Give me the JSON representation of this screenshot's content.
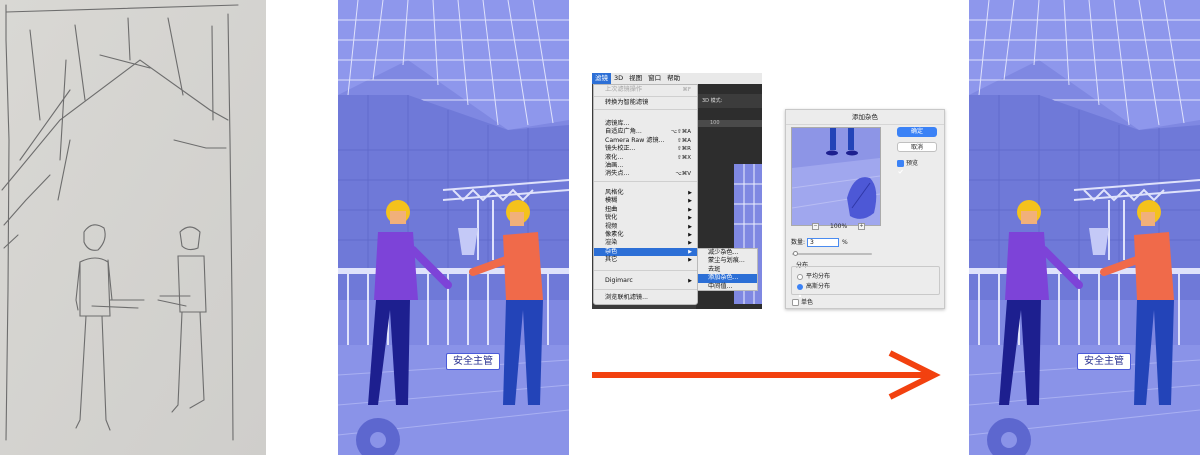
{
  "illustration": {
    "badge_label": "安全主管"
  },
  "photoshop_menu": {
    "menubar": [
      "滤镜",
      "3D",
      "视图",
      "窗口",
      "帮助"
    ],
    "active_menu": "滤镜",
    "options_bar_text": "3D 模式:",
    "ruler_text": "100",
    "items": [
      {
        "label": "上次滤镜操作",
        "shortcut": "⌘F",
        "disabled": true
      },
      {
        "label": "转换为智能滤镜",
        "shortcut": ""
      },
      {
        "label": "滤镜库...",
        "shortcut": ""
      },
      {
        "label": "自适应广角...",
        "shortcut": "⌥⇧⌘A"
      },
      {
        "label": "Camera Raw 滤镜...",
        "shortcut": "⇧⌘A"
      },
      {
        "label": "镜头校正...",
        "shortcut": "⇧⌘R"
      },
      {
        "label": "液化...",
        "shortcut": "⇧⌘X"
      },
      {
        "label": "油画...",
        "shortcut": ""
      },
      {
        "label": "消失点...",
        "shortcut": "⌥⌘V"
      },
      {
        "label": "风格化",
        "submenu": true
      },
      {
        "label": "模糊",
        "submenu": true
      },
      {
        "label": "扭曲",
        "submenu": true
      },
      {
        "label": "锐化",
        "submenu": true
      },
      {
        "label": "视频",
        "submenu": true
      },
      {
        "label": "像素化",
        "submenu": true
      },
      {
        "label": "渲染",
        "submenu": true
      },
      {
        "label": "杂色",
        "submenu": true,
        "highlighted": true
      },
      {
        "label": "其它",
        "submenu": true
      },
      {
        "label": "Digimarc",
        "submenu": true
      },
      {
        "label": "浏览联机滤镜..."
      }
    ],
    "noise_submenu": [
      {
        "label": "减少杂色..."
      },
      {
        "label": "蒙尘与划痕..."
      },
      {
        "label": "去斑"
      },
      {
        "label": "添加杂色...",
        "highlighted": true
      },
      {
        "label": "中间值..."
      }
    ]
  },
  "add_noise_dialog": {
    "title": "添加杂色",
    "ok_label": "确定",
    "cancel_label": "取消",
    "preview_label": "预览",
    "preview_checked": true,
    "zoom_level": "100%",
    "zoom_out": "−",
    "zoom_in": "+",
    "amount_label": "数量:",
    "amount_value": "3",
    "amount_unit": "%",
    "distribution_label": "分布",
    "uniform_label": "平均分布",
    "gaussian_label": "高斯分布",
    "gaussian_selected": true,
    "monochrome_label": "单色",
    "monochrome_checked": false
  },
  "colors": {
    "accent_blue": "#2c6fd6",
    "arrow": "#f2410f",
    "illustration_bg": "#7f88e2"
  }
}
